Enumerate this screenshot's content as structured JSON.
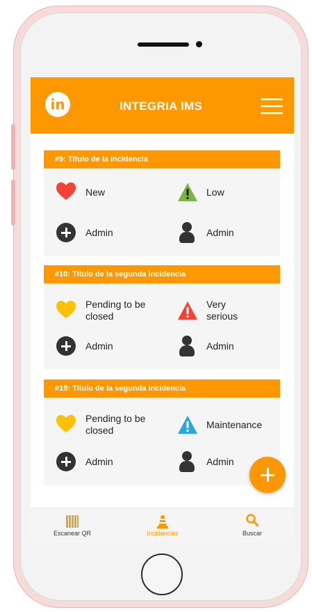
{
  "app": {
    "title": "INTEGRIA IMS",
    "logo_text": "in"
  },
  "colors": {
    "accent": "#ff9800",
    "heart_red": "#f44336",
    "heart_yellow": "#ffc107",
    "tri_green": "#7cb342",
    "tri_red": "#f44336",
    "tri_blue": "#29a8e0",
    "dark": "#333333"
  },
  "incidents": [
    {
      "header": "#9:  Título de la incidencia",
      "status": "New",
      "priority": "Low",
      "creator": "Admin",
      "owner": "Admin"
    },
    {
      "header": "#10:  Título de la segunda incidencia",
      "status": "Pending to be closed",
      "priority": "Very serious",
      "creator": "Admin",
      "owner": "Admin"
    },
    {
      "header": "#19:  Título de la segunda incidencia",
      "status": "Pending to be closed",
      "priority": "Maintenance",
      "creator": "Admin",
      "owner": "Admin"
    }
  ],
  "bottom_nav": [
    {
      "label": "Escanear QR",
      "icon": "qr-code-icon"
    },
    {
      "label": "Incidencias",
      "icon": "traffic-cone-icon",
      "active": true
    },
    {
      "label": "Buscar",
      "icon": "search-icon"
    }
  ]
}
